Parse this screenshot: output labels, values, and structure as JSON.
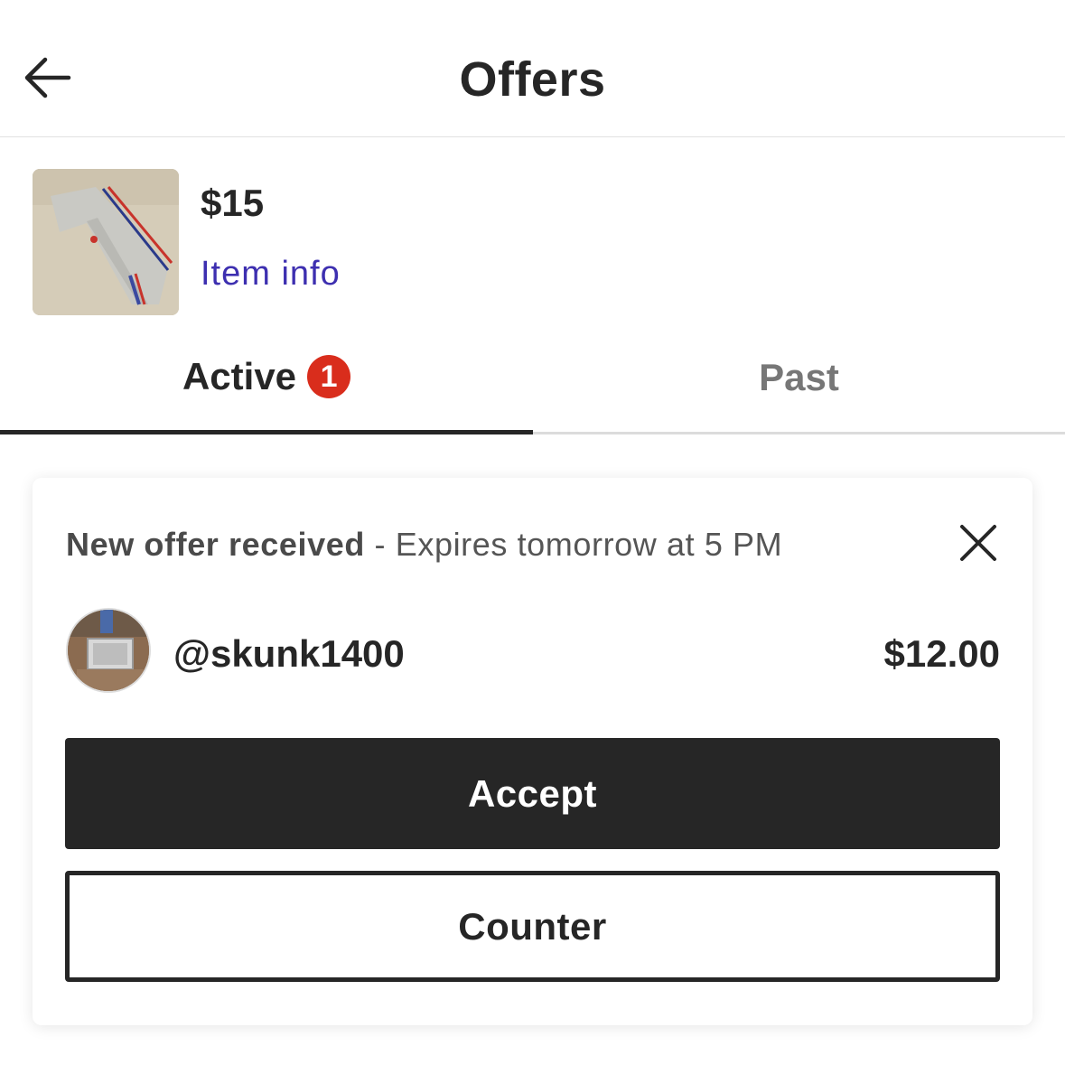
{
  "header": {
    "title": "Offers",
    "back_icon": "arrow-left-icon"
  },
  "item": {
    "price": "$15",
    "info_link": "Item info"
  },
  "tabs": [
    {
      "label": "Active",
      "badge": "1",
      "active": true
    },
    {
      "label": "Past",
      "active": false
    }
  ],
  "offer": {
    "status": "New offer received",
    "expiry": " - Expires tomorrow at 5 PM",
    "username": "@skunk1400",
    "amount": "$12.00",
    "accept_label": "Accept",
    "counter_label": "Counter",
    "close_icon": "close-icon"
  },
  "colors": {
    "accent_link": "#3d2fb0",
    "badge": "#d92d1c",
    "primary_button": "#262626"
  }
}
